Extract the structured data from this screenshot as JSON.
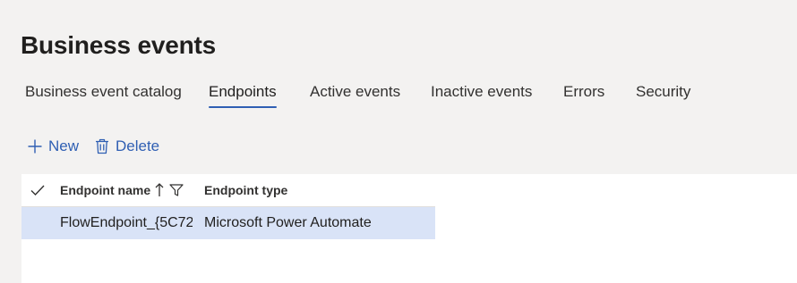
{
  "page": {
    "title": "Business events"
  },
  "tabs": [
    {
      "label": "Business event catalog",
      "active": false
    },
    {
      "label": "Endpoints",
      "active": true
    },
    {
      "label": "Active events",
      "active": false
    },
    {
      "label": "Inactive events",
      "active": false
    },
    {
      "label": "Errors",
      "active": false
    },
    {
      "label": "Security",
      "active": false
    }
  ],
  "toolbar": {
    "new_label": "New",
    "new_icon": "plus-icon",
    "delete_label": "Delete",
    "delete_icon": "trash-icon"
  },
  "grid": {
    "columns": [
      {
        "label": "Endpoint name",
        "sort": "ascending",
        "filter": true
      },
      {
        "label": "Endpoint type"
      }
    ],
    "rows": [
      {
        "endpoint_name": "FlowEndpoint_{5C72",
        "endpoint_type": "Microsoft Power Automate",
        "selected": true
      }
    ]
  },
  "colors": {
    "accent": "#2f5fb3",
    "background": "#f3f2f1",
    "selected_row": "#d9e3f7"
  }
}
